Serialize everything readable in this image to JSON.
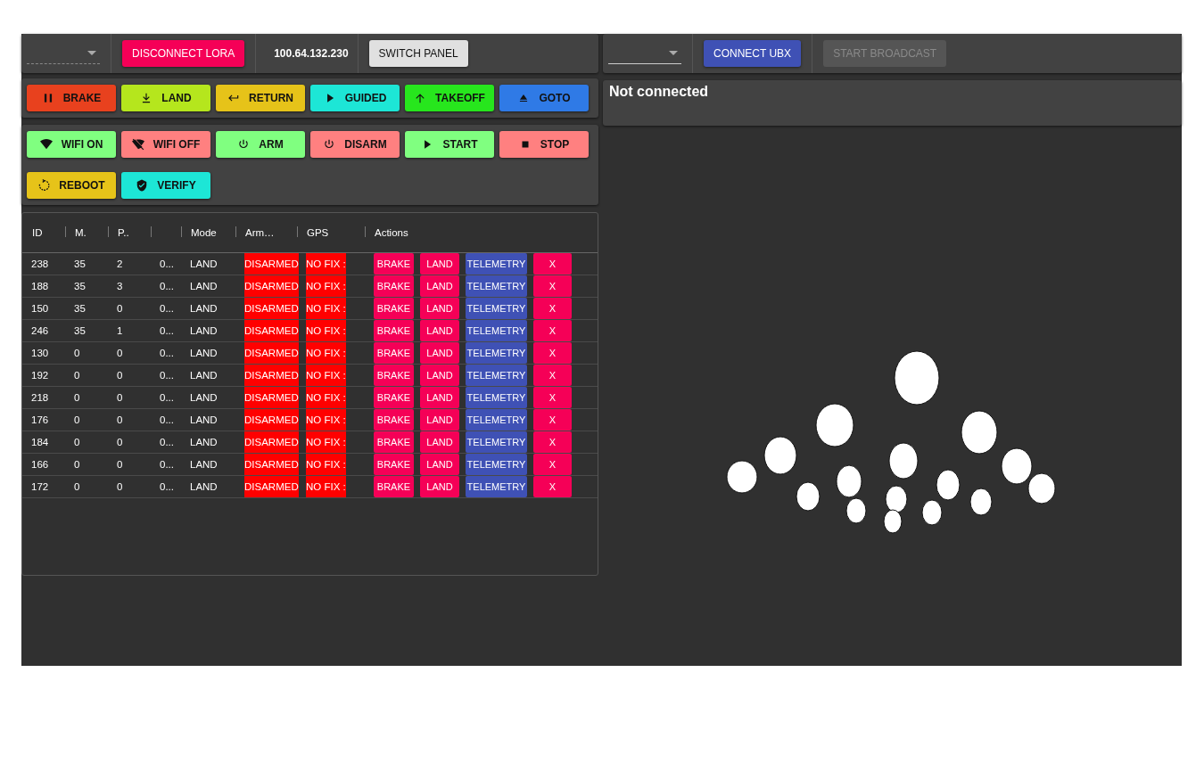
{
  "left_toolbar": {
    "disconnect_button": "DISCONNECT LORA",
    "ip_address": "100.64.132.230",
    "switch_button": "SWITCH PANEL"
  },
  "flight_commands": [
    {
      "label": "BRAKE",
      "color": "#e8411e"
    },
    {
      "label": "LAND",
      "color": "#b5e61d"
    },
    {
      "label": "RETURN",
      "color": "#e6c319"
    },
    {
      "label": "GUIDED",
      "color": "#1de6d6"
    },
    {
      "label": "TAKEOFF",
      "color": "#27e61d"
    },
    {
      "label": "GOTO",
      "color": "#2f7ae6"
    }
  ],
  "system_commands": [
    {
      "label": "WIFI ON",
      "color": "#80ff80"
    },
    {
      "label": "WIFI OFF",
      "color": "#ff8080"
    },
    {
      "label": "ARM",
      "color": "#80ff80"
    },
    {
      "label": "DISARM",
      "color": "#ff8080"
    },
    {
      "label": "START",
      "color": "#80ff80"
    },
    {
      "label": "STOP",
      "color": "#ff8080"
    },
    {
      "label": "REBOOT",
      "color": "#e6c319"
    },
    {
      "label": "VERIFY",
      "color": "#1de6d6"
    }
  ],
  "table": {
    "columns": [
      "ID",
      "M.",
      "P..",
      "",
      "Mode",
      "Arm…",
      "GPS",
      "Actions"
    ],
    "rows": [
      {
        "id": "238",
        "m": "35",
        "p": "2",
        "column_4": "0...",
        "mode": "LAND",
        "armed": "DISARMED",
        "gps": "NO FIX :",
        "actions": [
          "BRAKE",
          "LAND",
          "TELEMETRY",
          "X"
        ]
      },
      {
        "id": "188",
        "m": "35",
        "p": "3",
        "column_4": "0...",
        "mode": "LAND",
        "armed": "DISARMED",
        "gps": "NO FIX :",
        "actions": [
          "BRAKE",
          "LAND",
          "TELEMETRY",
          "X"
        ]
      },
      {
        "id": "150",
        "m": "35",
        "p": "0",
        "column_4": "0...",
        "mode": "LAND",
        "armed": "DISARMED",
        "gps": "NO FIX :",
        "actions": [
          "BRAKE",
          "LAND",
          "TELEMETRY",
          "X"
        ]
      },
      {
        "id": "246",
        "m": "35",
        "p": "1",
        "column_4": "0...",
        "mode": "LAND",
        "armed": "DISARMED",
        "gps": "NO FIX :",
        "actions": [
          "BRAKE",
          "LAND",
          "TELEMETRY",
          "X"
        ]
      },
      {
        "id": "130",
        "m": "0",
        "p": "0",
        "column_4": "0...",
        "mode": "LAND",
        "armed": "DISARMED",
        "gps": "NO FIX :",
        "actions": [
          "BRAKE",
          "LAND",
          "TELEMETRY",
          "X"
        ]
      },
      {
        "id": "192",
        "m": "0",
        "p": "0",
        "column_4": "0...",
        "mode": "LAND",
        "armed": "DISARMED",
        "gps": "NO FIX :",
        "actions": [
          "BRAKE",
          "LAND",
          "TELEMETRY",
          "X"
        ]
      },
      {
        "id": "218",
        "m": "0",
        "p": "0",
        "column_4": "0...",
        "mode": "LAND",
        "armed": "DISARMED",
        "gps": "NO FIX :",
        "actions": [
          "BRAKE",
          "LAND",
          "TELEMETRY",
          "X"
        ]
      },
      {
        "id": "176",
        "m": "0",
        "p": "0",
        "column_4": "0...",
        "mode": "LAND",
        "armed": "DISARMED",
        "gps": "NO FIX :",
        "actions": [
          "BRAKE",
          "LAND",
          "TELEMETRY",
          "X"
        ]
      },
      {
        "id": "184",
        "m": "0",
        "p": "0",
        "column_4": "0...",
        "mode": "LAND",
        "armed": "DISARMED",
        "gps": "NO FIX :",
        "actions": [
          "BRAKE",
          "LAND",
          "TELEMETRY",
          "X"
        ]
      },
      {
        "id": "166",
        "m": "0",
        "p": "0",
        "column_4": "0...",
        "mode": "LAND",
        "armed": "DISARMED",
        "gps": "NO FIX :",
        "actions": [
          "BRAKE",
          "LAND",
          "TELEMETRY",
          "X"
        ]
      },
      {
        "id": "172",
        "m": "0",
        "p": "0",
        "column_4": "0...",
        "mode": "LAND",
        "armed": "DISARMED",
        "gps": "NO FIX :",
        "actions": [
          "BRAKE",
          "LAND",
          "TELEMETRY",
          "X"
        ]
      }
    ]
  },
  "right_toolbar": {
    "connect_button": "CONNECT UBX",
    "broadcast_button": {
      "label": "START BROADCAST",
      "disabled": true
    }
  },
  "status": "Not connected"
}
